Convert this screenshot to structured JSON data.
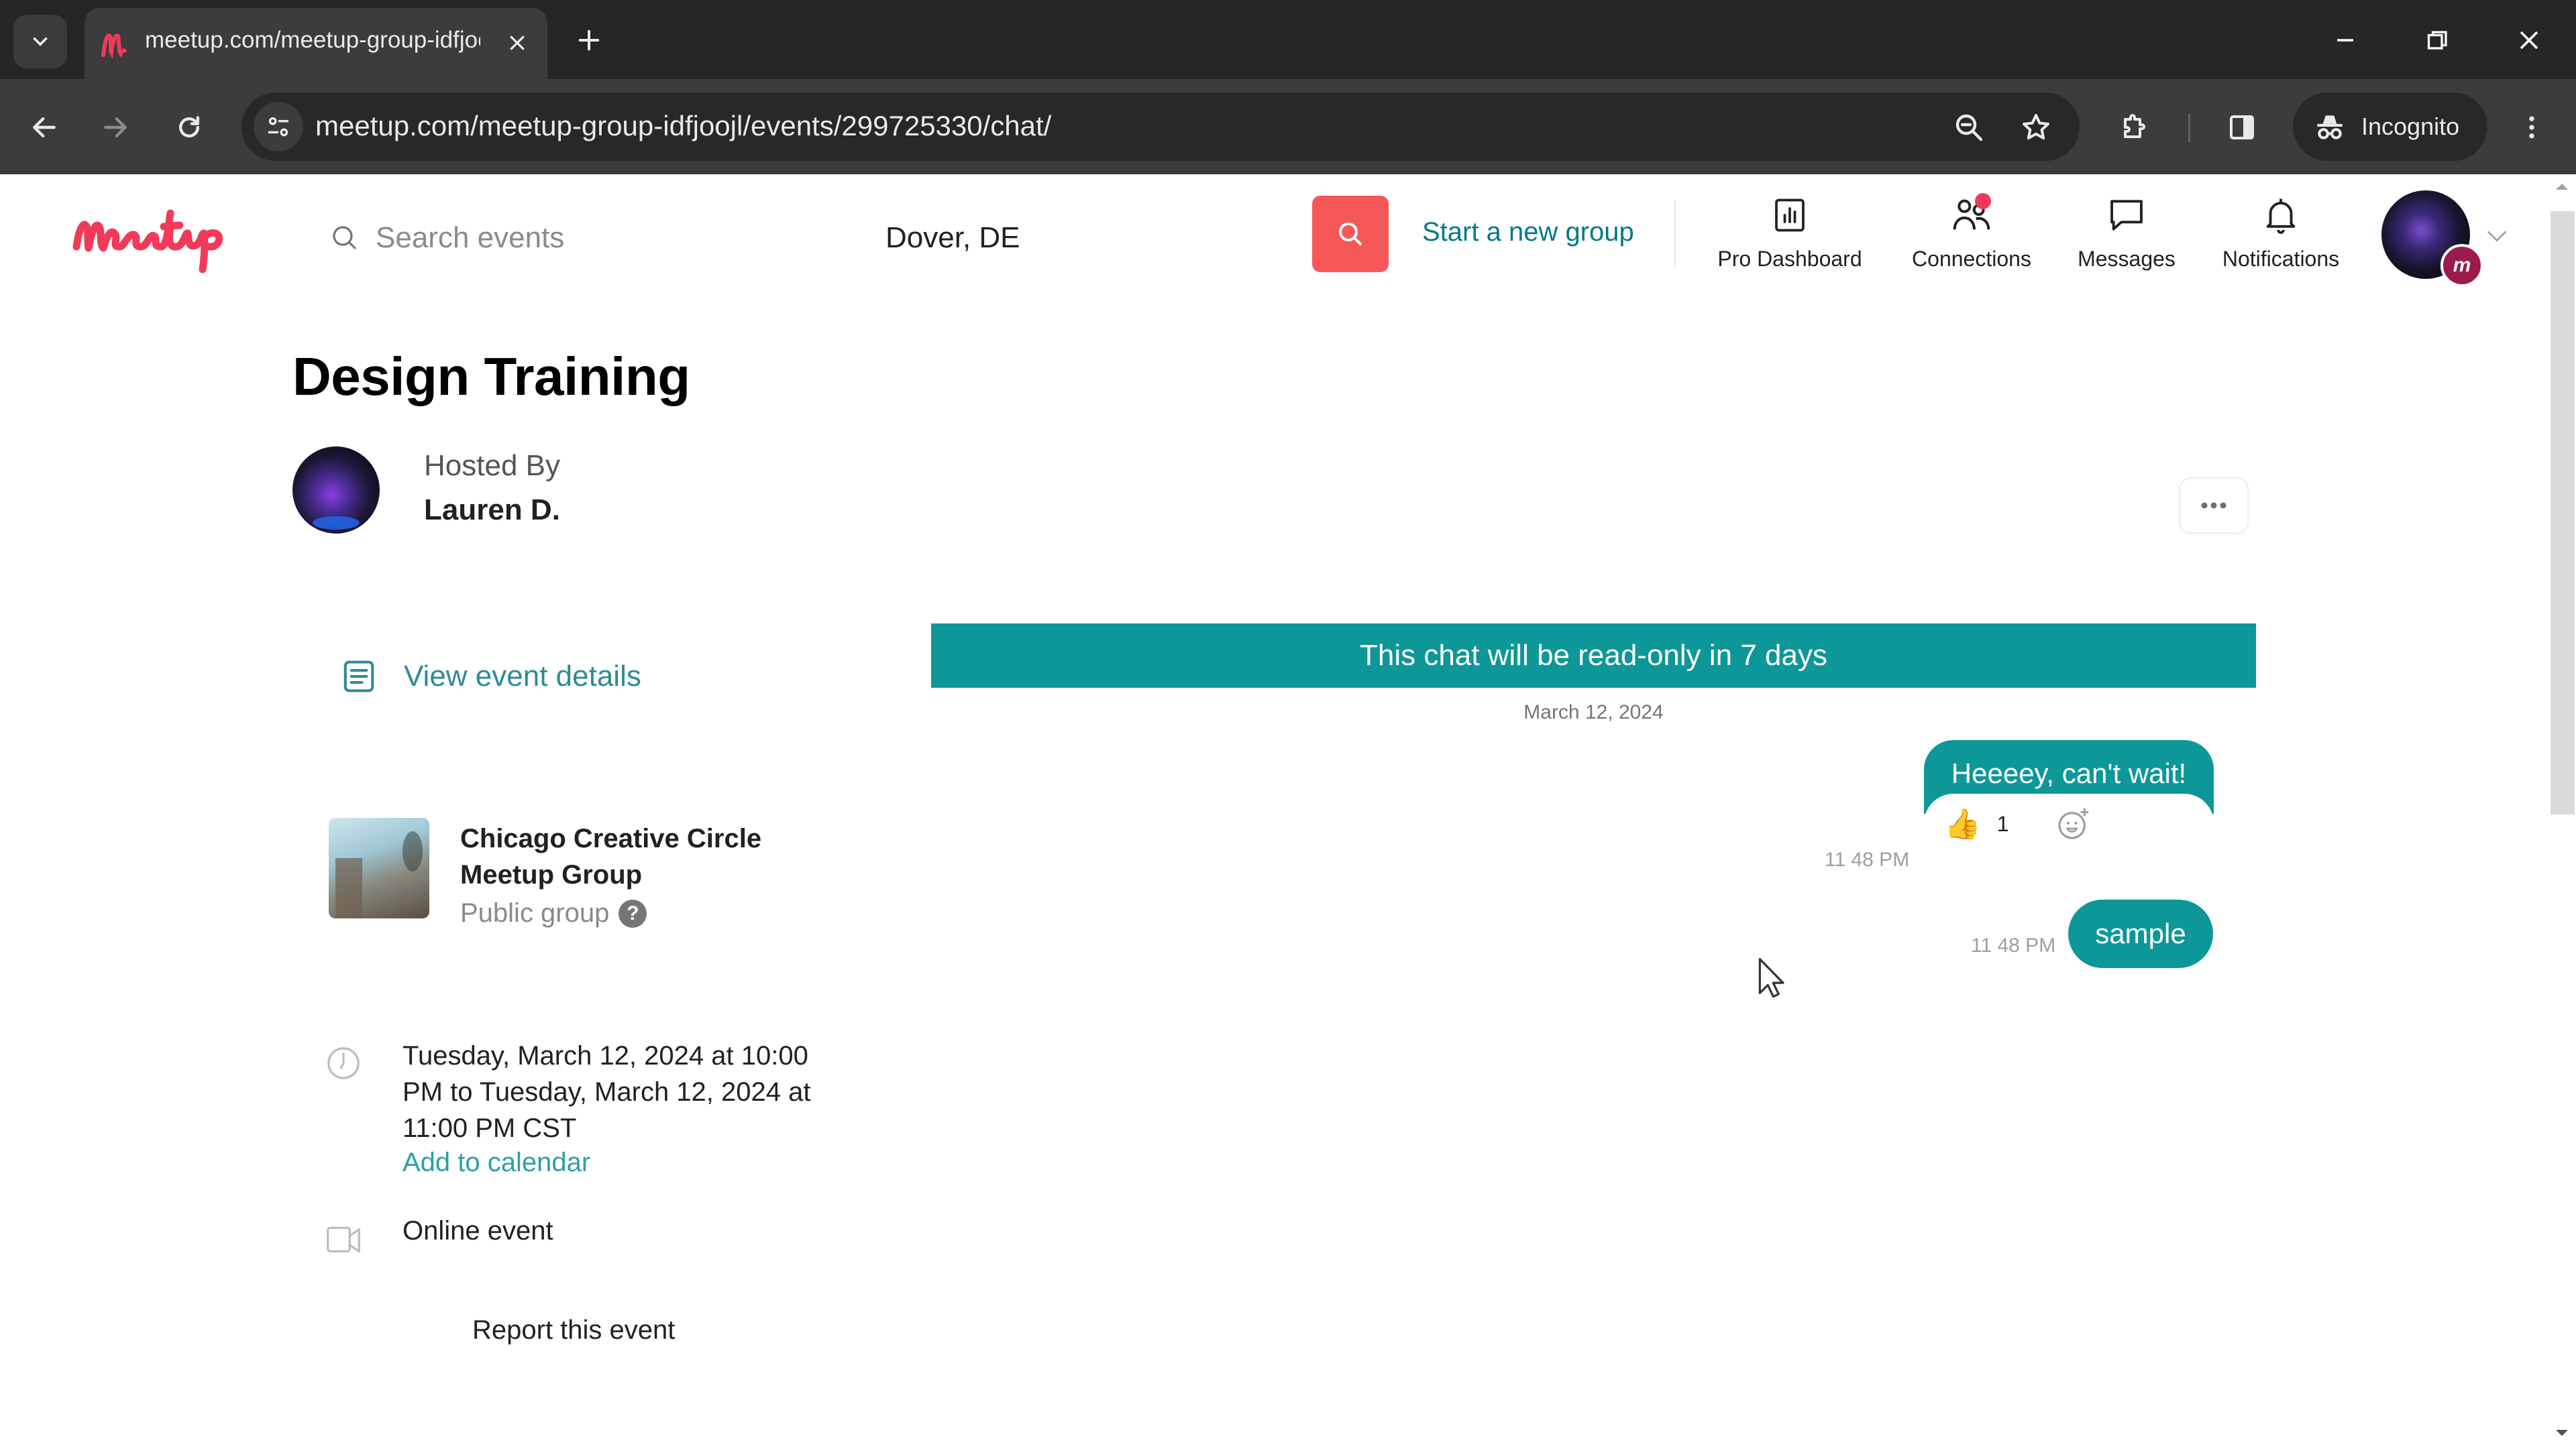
{
  "browser": {
    "tab_title": "meetup.com/meetup-group-idfjoojl/events/299725330/chat/",
    "url": "meetup.com/meetup-group-idfjoojl/events/299725330/chat/",
    "incognito_label": "Incognito",
    "icons": {
      "tab_list": "chevron-down-icon",
      "favicon": "meetup-favicon",
      "tab_close": "close-icon",
      "new_tab": "plus-icon",
      "minimize": "minimize-icon",
      "restore": "restore-icon",
      "close_window": "close-icon",
      "back": "arrow-left-icon",
      "forward": "arrow-right-icon",
      "reload": "reload-icon",
      "site_info": "tune-icon",
      "zoom": "zoom-out-icon",
      "bookmark": "star-icon",
      "extensions": "puzzle-icon",
      "side_panel": "side-panel-icon",
      "incognito": "incognito-icon",
      "menu": "kebab-menu-icon"
    }
  },
  "header": {
    "logo_text": "Meetup",
    "search_placeholder": "Search events",
    "search_value": "",
    "location_value": "Dover, DE",
    "start_group_label": "Start a new group",
    "nav": [
      {
        "label": "Pro Dashboard",
        "icon": "bar-chart-icon"
      },
      {
        "label": "Connections",
        "icon": "people-icon",
        "has_notification_dot": true
      },
      {
        "label": "Messages",
        "icon": "chat-bubble-icon"
      },
      {
        "label": "Notifications",
        "icon": "bell-icon"
      }
    ],
    "avatar_badge": "m"
  },
  "event": {
    "title": "Design Training",
    "hosted_by_label": "Hosted By",
    "host_name": "Lauren D.",
    "view_details_label": "View event details",
    "group": {
      "name": "Chicago Creative Circle Meetup Group",
      "visibility": "Public group",
      "help": "?"
    },
    "time_text": "Tuesday, March 12, 2024 at 10:00 PM to Tuesday, March 12, 2024 at 11:00 PM CST",
    "add_to_calendar_label": "Add to calendar",
    "location_type": "Online event",
    "report_label": "Report this event"
  },
  "chat": {
    "banner": "This chat will be read-only in 7 days",
    "date_divider": "March 12, 2024",
    "messages": [
      {
        "text": "Heeeey, can't wait!",
        "time": "11 48 PM",
        "reaction_emoji": "👍",
        "reaction_count": "1"
      },
      {
        "text": "sample",
        "time": "11 48 PM"
      }
    ]
  },
  "colors": {
    "brand_red": "#f65858",
    "logo_pink": "#f13a59",
    "teal": "#0d9799",
    "link_teal": "#00798a"
  }
}
